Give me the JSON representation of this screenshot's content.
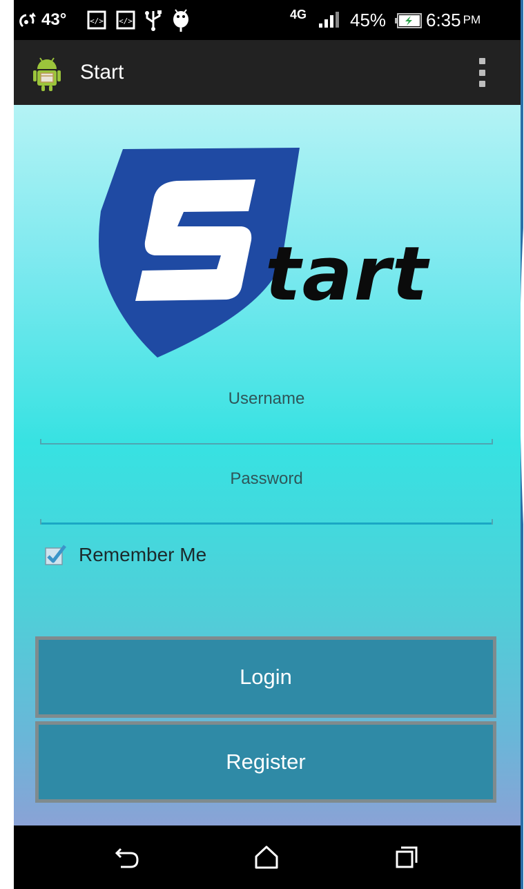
{
  "status_bar": {
    "temperature": "43°",
    "network": "4G",
    "battery_percent": "45%",
    "time": "6:35",
    "time_suffix": "PM",
    "icons": [
      "hotspot-icon",
      "code-notification-icon",
      "code-notification-icon",
      "usb-icon",
      "android-debug-icon",
      "signal-icon",
      "battery-charging-icon"
    ]
  },
  "action_bar": {
    "title": "Start",
    "app_icon": "android-app-icon",
    "menu_icon": "overflow-menu-icon"
  },
  "logo": {
    "text": "tart",
    "shield_color": "#1f4aa3",
    "letter_s_color": "#ffffff"
  },
  "form": {
    "username_placeholder": "Username",
    "username_value": "",
    "password_placeholder": "Password",
    "password_value": "",
    "remember_label": "Remember Me",
    "remember_checked": true
  },
  "buttons": {
    "login": "Login",
    "register": "Register"
  },
  "colors": {
    "button_bg": "#2f8aa6",
    "button_border": "#7f8b8e",
    "action_bar_bg": "#222222",
    "checkbox_accent": "#3a95c9"
  },
  "nav_bar": {
    "icons": [
      "back-icon",
      "home-icon",
      "recent-apps-icon"
    ]
  }
}
